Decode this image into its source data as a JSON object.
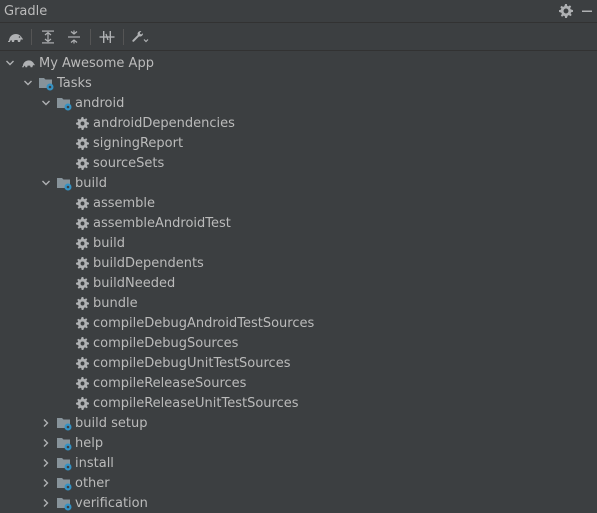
{
  "window": {
    "title": "Gradle"
  },
  "tree": {
    "root": {
      "label": "My Awesome App"
    },
    "tasks": {
      "label": "Tasks"
    },
    "groups": {
      "android": {
        "label": "android",
        "items": [
          "androidDependencies",
          "signingReport",
          "sourceSets"
        ]
      },
      "build": {
        "label": "build",
        "items": [
          "assemble",
          "assembleAndroidTest",
          "build",
          "buildDependents",
          "buildNeeded",
          "bundle",
          "compileDebugAndroidTestSources",
          "compileDebugSources",
          "compileDebugUnitTestSources",
          "compileReleaseSources",
          "compileReleaseUnitTestSources"
        ]
      }
    },
    "collapsed": [
      "build setup",
      "help",
      "install",
      "other",
      "verification"
    ]
  },
  "colors": {
    "background": "#3c3f41",
    "text": "#bbbbbb",
    "folder": "#87939a",
    "gear": "#afb1b3",
    "badge": "#3592c4"
  }
}
